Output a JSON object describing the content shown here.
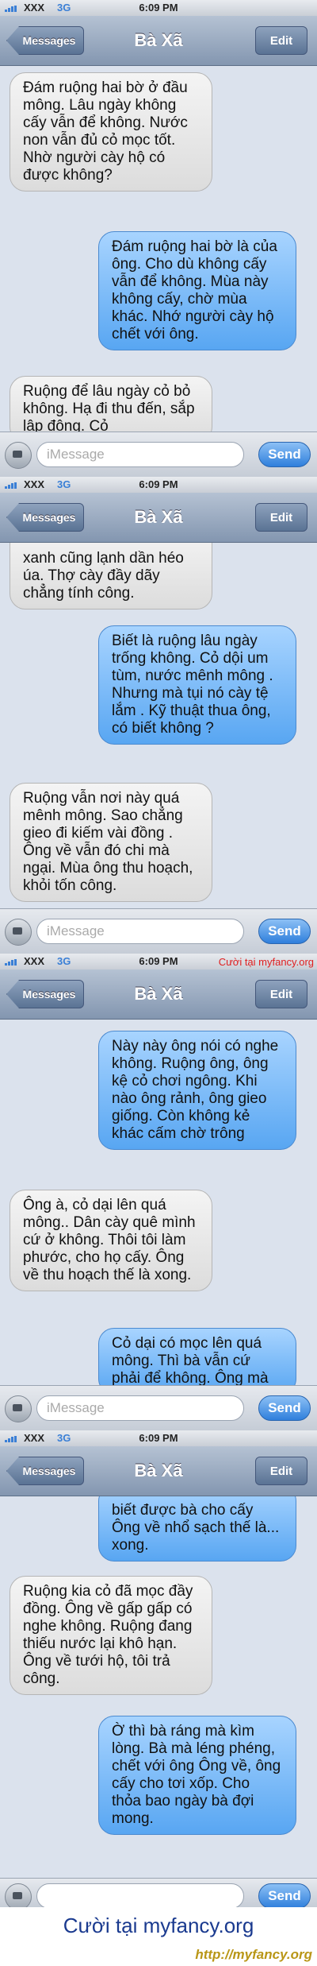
{
  "screens": [
    {
      "status": {
        "carrier": "XXX",
        "network": "3G",
        "time": "6:09 PM",
        "watermark": ""
      },
      "nav": {
        "back": "Messages",
        "title": "Bà Xã",
        "edit": "Edit"
      },
      "messages": [
        {
          "type": "recv",
          "text": "Đám ruộng hai bờ ở đầu mông. Lâu ngày không cấy vẫn để không.  Nước non vẫn đủ cỏ mọc tốt. Nhờ người cày hộ có được không?"
        },
        {
          "type": "sent",
          "text": "Đám ruộng hai bờ là của ông.  Cho dù không cấy vẫn để không.  Mùa này không cấy, chờ mùa khác. Nhớ người cày hộ chết với ông."
        },
        {
          "type": "recv",
          "text": "Ruộng để lâu ngày cỏ bỏ không.  Hạ đi thu đến, sắp lập đông. Cỏ"
        }
      ],
      "input": {
        "placeholder": "iMessage",
        "send": "Send"
      }
    },
    {
      "status": {
        "carrier": "XXX",
        "network": "3G",
        "time": "6:09 PM",
        "watermark": ""
      },
      "nav": {
        "back": "Messages",
        "title": "Bà Xã",
        "edit": "Edit"
      },
      "messages": [
        {
          "type": "recv",
          "text": "xanh cũng lạnh dần héo úa. Thợ cày đầy dãy chẳng tính công."
        },
        {
          "type": "sent",
          "text": "Biết là ruộng lâu ngày trống không.  Cỏ dội um tùm, nước mênh mông .  Nhưng mà tụi nó cày tệ lắm . Kỹ thuật thua ông, có biết không ?"
        },
        {
          "type": "recv",
          "text": "Ruộng vẫn nơi này quá mênh mông.  Sao chẳng gieo đi kiếm vài đồng . Ông về vẫn đó chi mà ngại. Mùa ông thu hoạch, khỏi tốn công."
        }
      ],
      "input": {
        "placeholder": "iMessage",
        "send": "Send"
      }
    },
    {
      "status": {
        "carrier": "XXX",
        "network": "3G",
        "time": "6:09 PM",
        "watermark": "Cười tại myfancy.org"
      },
      "nav": {
        "back": "Messages",
        "title": "Bà Xã",
        "edit": "Edit"
      },
      "messages": [
        {
          "type": "sent",
          "text": "Này này ông nói có nghe không.  Ruộng ông, ông kệ cỏ chơi ngông.  Khi nào ông rảnh, ông gieo giống. Còn không kẻ khác cấm chờ trông"
        },
        {
          "type": "recv",
          "text": "Ông à, cỏ dại lên quá mông.. Dân cày quê mình cứ ở không.  Thôi tôi làm phước, cho họ cấy. Ông về thu hoạch thế là xong."
        },
        {
          "type": "sent",
          "text": "Cỏ dại có mọc lên quá mông. Thì bà vẫn cứ phải để không. Ông mà"
        }
      ],
      "input": {
        "placeholder": "iMessage",
        "send": "Send"
      }
    },
    {
      "status": {
        "carrier": "XXX",
        "network": "3G",
        "time": "6:09 PM",
        "watermark": ""
      },
      "nav": {
        "back": "Messages",
        "title": "Bà Xã",
        "edit": "Edit"
      },
      "messages": [
        {
          "type": "sent",
          "text": "biết được bà cho cấy Ông về nhổ sạch thế là... xong."
        },
        {
          "type": "recv",
          "text": "Ruộng kia cỏ đã mọc đầy đồng.  Ông về gấp gấp có nghe không.  Ruộng đang thiếu nước lại khô hạn.  Ông về tưới hộ, tôi trả công."
        },
        {
          "type": "sent",
          "text": "Ờ thì bà ráng mà kìm lòng.  Bà mà léng phéng, chết với ông Ông về, ông cấy cho tơi xốp.  Cho thỏa bao ngày bà đợi mong."
        }
      ],
      "input": {
        "placeholder": "",
        "send": "Send"
      }
    }
  ],
  "footer": {
    "brand": "Cười tại myfancy.org",
    "url": "http://myfancy.org"
  }
}
